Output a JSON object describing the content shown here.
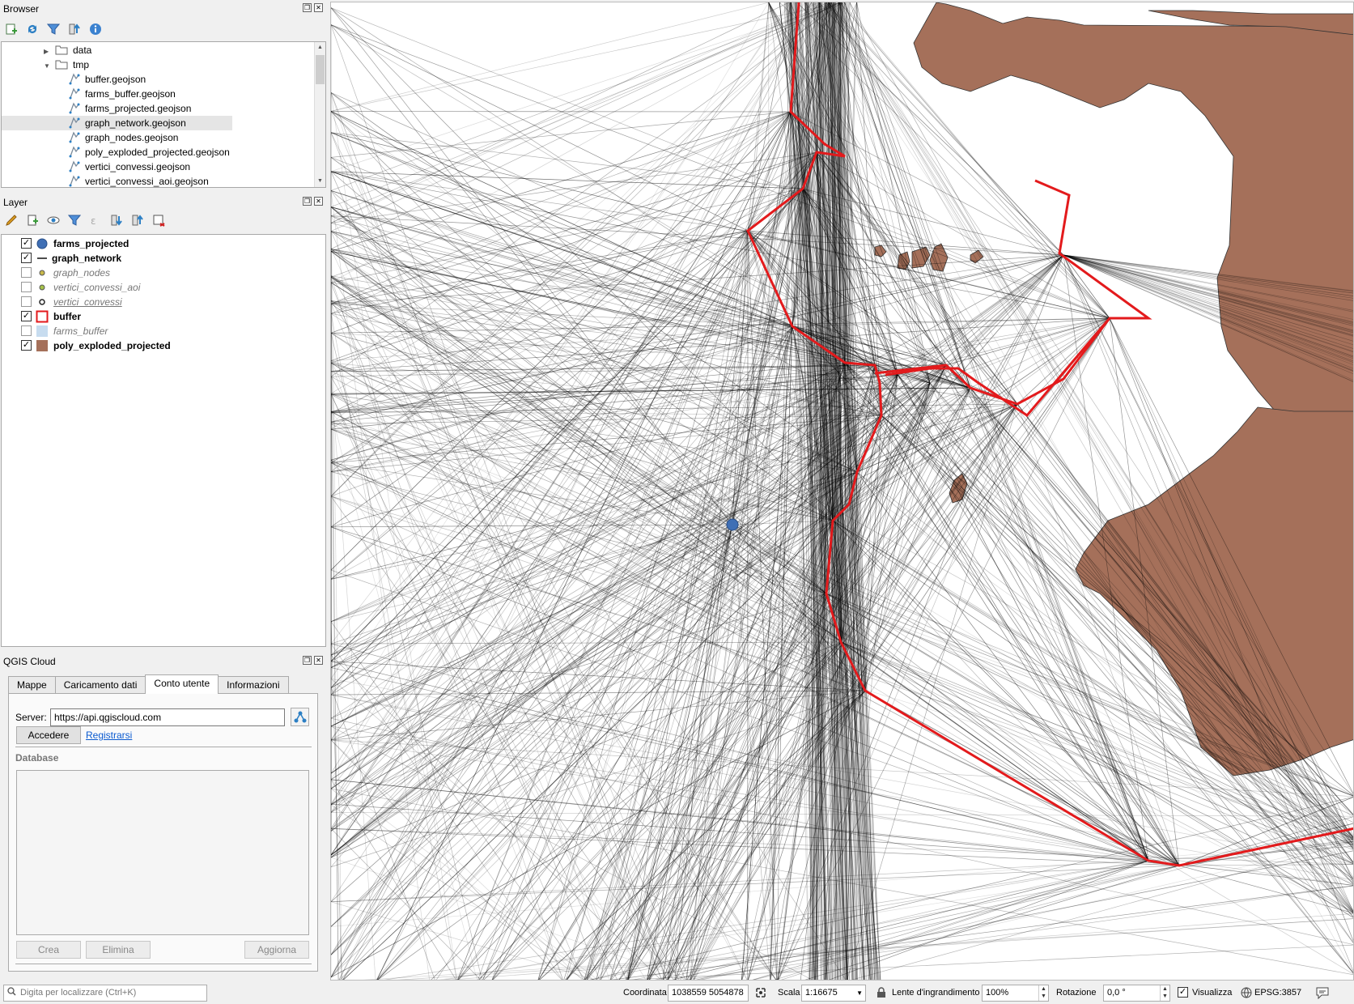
{
  "browser": {
    "title": "Browser",
    "tree": [
      {
        "label": "data",
        "level": 1,
        "type": "folder",
        "expanded": false
      },
      {
        "label": "tmp",
        "level": 1,
        "type": "folder",
        "expanded": true
      },
      {
        "label": "buffer.geojson",
        "level": 2,
        "type": "file"
      },
      {
        "label": "farms_buffer.geojson",
        "level": 2,
        "type": "file"
      },
      {
        "label": "farms_projected.geojson",
        "level": 2,
        "type": "file"
      },
      {
        "label": "graph_network.geojson",
        "level": 2,
        "type": "file",
        "selected": true
      },
      {
        "label": "graph_nodes.geojson",
        "level": 2,
        "type": "file"
      },
      {
        "label": "poly_exploded_projected.geojson",
        "level": 2,
        "type": "file"
      },
      {
        "label": "vertici_convessi.geojson",
        "level": 2,
        "type": "file"
      },
      {
        "label": "vertici_convessi_aoi.geojson",
        "level": 2,
        "type": "file"
      }
    ]
  },
  "layers": {
    "title": "Layer",
    "items": [
      {
        "label": "farms_projected",
        "checked": true,
        "symbol": "point-blue",
        "style": "bold"
      },
      {
        "label": "graph_network",
        "checked": true,
        "symbol": "line-black",
        "style": "bold"
      },
      {
        "label": "graph_nodes",
        "checked": false,
        "symbol": "point-olive",
        "style": "italic"
      },
      {
        "label": "vertici_convessi_aoi",
        "checked": false,
        "symbol": "point-olive-green",
        "style": "italic"
      },
      {
        "label": "vertici_convessi",
        "checked": false,
        "symbol": "point-hollow",
        "style": "italic-underline"
      },
      {
        "label": "buffer",
        "checked": true,
        "symbol": "polygon-red-outline",
        "style": "bold"
      },
      {
        "label": "farms_buffer",
        "checked": false,
        "symbol": "polygon-lightblue",
        "style": "italic"
      },
      {
        "label": "poly_exploded_projected",
        "checked": true,
        "symbol": "polygon-brown",
        "style": "bold"
      }
    ]
  },
  "cloud": {
    "title": "QGIS Cloud",
    "tabs": [
      "Mappe",
      "Caricamento dati",
      "Conto utente",
      "Informazioni"
    ],
    "active_tab": "Conto utente",
    "server_label": "Server:",
    "server_value": "https://api.qgiscloud.com",
    "login_button": "Accedere",
    "register_link": "Registrarsi",
    "database_label": "Database",
    "create_button": "Crea",
    "delete_button": "Elimina",
    "refresh_button": "Aggiorna"
  },
  "statusbar": {
    "locator_placeholder": "Digita per localizzare (Ctrl+K)",
    "coord_label": "Coordinata",
    "coord_value": "1038559 5054878",
    "scale_label": "Scala",
    "scale_value": "1:16675",
    "magnifier_label": "Lente d'ingrandimento",
    "magnifier_value": "100%",
    "rotation_label": "Rotazione",
    "rotation_value": "0,0 °",
    "render_label": "Visualizza",
    "crs_label": "EPSG:3857"
  },
  "colors": {
    "polygon_fill": "#a5705a",
    "buffer_outline": "#e31a1c",
    "farm_point": "#3f6fb5",
    "network_line": "#000000"
  }
}
